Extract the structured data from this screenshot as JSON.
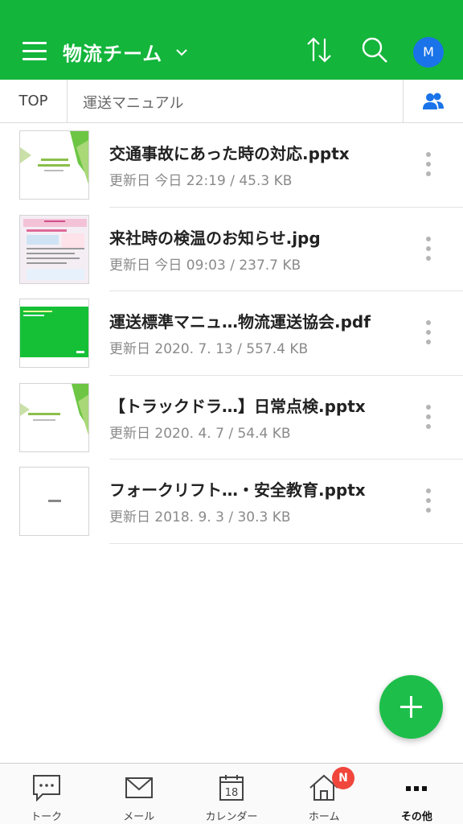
{
  "header": {
    "team_name": "物流チーム",
    "avatar_initial": "M"
  },
  "breadcrumb": {
    "root": "TOP",
    "current": "運送マニュアル"
  },
  "files": [
    {
      "name": "交通事故にあった時の対応.pptx",
      "meta": "更新日 今日 22:19 / 45.3 KB"
    },
    {
      "name": "来社時の検温のお知らせ.jpg",
      "meta": "更新日 今日 09:03 / 237.7 KB"
    },
    {
      "name": "運送標準マニュ…物流運送協会.pdf",
      "meta": "更新日 2020. 7. 13 / 557.4 KB"
    },
    {
      "name": "【トラックドラ…】日常点検.pptx",
      "meta": "更新日 2020. 4. 7 / 54.4 KB"
    },
    {
      "name": "フォークリフト…・安全教育.pptx",
      "meta": "更新日 2018. 9. 3 / 30.3 KB"
    }
  ],
  "tabbar": {
    "tabs": [
      {
        "label": "トーク",
        "icon": "chat-icon"
      },
      {
        "label": "メール",
        "icon": "mail-icon"
      },
      {
        "label": "カレンダー",
        "icon": "calendar-icon",
        "calendar_day": "18"
      },
      {
        "label": "ホーム",
        "icon": "home-icon"
      },
      {
        "label": "その他",
        "icon": "more-icon"
      }
    ],
    "home_badge": "N"
  },
  "colors": {
    "brand_green": "#13b53b",
    "fab_green": "#1dbf4a",
    "avatar_blue": "#1a73e8",
    "badge_red": "#f0463c"
  }
}
